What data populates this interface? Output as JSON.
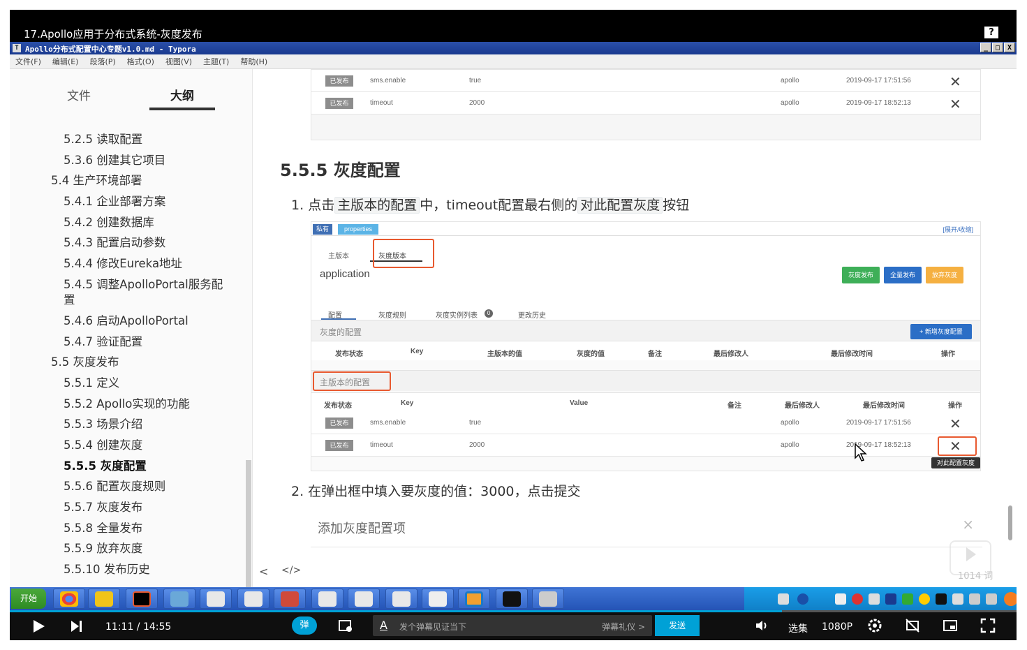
{
  "video": {
    "title": "17.Apollo应用于分布式系统-灰度发布",
    "help": "?"
  },
  "window": {
    "title": "Apollo分布式配置中心专题v1.0.md - Typora",
    "icon": "T",
    "buttons": [
      "_",
      "□",
      "X"
    ]
  },
  "menu": [
    "文件(F)",
    "编辑(E)",
    "段落(P)",
    "格式(O)",
    "视图(V)",
    "主题(T)",
    "帮助(H)"
  ],
  "sidebar": {
    "tab_file": "文件",
    "tab_outline": "大纲",
    "items": [
      {
        "label": "5.2.5 读取配置"
      },
      {
        "label": "5.3.6 创建其它项目"
      },
      {
        "label": "5.4 生产环境部署"
      },
      {
        "label": "5.4.1 企业部署方案"
      },
      {
        "label": "5.4.2 创建数据库"
      },
      {
        "label": "5.4.3 配置启动参数"
      },
      {
        "label": "5.4.4 修改Eureka地址"
      },
      {
        "label": "5.4.5 调整ApolloPortal服务配"
      },
      {
        "label": "置"
      },
      {
        "label": "5.4.6 启动ApolloPortal"
      },
      {
        "label": "5.4.7 验证配置"
      },
      {
        "label": "5.5 灰度发布"
      },
      {
        "label": "5.5.1 定义"
      },
      {
        "label": "5.5.2 Apollo实现的功能"
      },
      {
        "label": "5.5.3 场景介绍"
      },
      {
        "label": "5.5.4 创建灰度"
      },
      {
        "label": "5.5.5 灰度配置"
      },
      {
        "label": "5.5.6 配置灰度规则"
      },
      {
        "label": "5.5.7 灰度发布"
      },
      {
        "label": "5.5.8 全量发布"
      },
      {
        "label": "5.5.9 放弃灰度"
      },
      {
        "label": "5.5.10 发布历史"
      }
    ]
  },
  "doc": {
    "heading": "5.5.5 灰度配置",
    "step1_num": "1.",
    "step1_a": "点击",
    "step1_code1": "主版本的配置",
    "step1_b": "中，timeout配置最右侧的",
    "step1_code2": "对此配置灰度",
    "step1_c": "按钮",
    "step2": "2. 在弹出框中填入要灰度的值：3000，点击提交",
    "dialog_title": "添加灰度配置项",
    "dialog_close": "×",
    "nav_back": "<",
    "nav_code": "</>"
  },
  "shot1": {
    "rows": [
      {
        "status": "已发布",
        "key": "sms.enable",
        "value": "true",
        "user": "apollo",
        "time": "2019-09-17 17:51:56"
      },
      {
        "status": "已发布",
        "key": "timeout",
        "value": "2000",
        "user": "apollo",
        "time": "2019-09-17 18:52:13"
      }
    ]
  },
  "shot2": {
    "tag1": "私有",
    "tag2": "properties",
    "expand": "[展开/收缩]",
    "tab_main": "主版本",
    "tab_gray": "灰度版本",
    "app": "application",
    "btn_gray_publish": "灰度发布",
    "btn_full_publish": "全量发布",
    "btn_abandon": "放弃灰度",
    "subtabs": [
      "配置",
      "灰度规则",
      "灰度实例列表",
      "更改历史"
    ],
    "instance_count": "0",
    "gray_section": "灰度的配置",
    "add_gray": "+ 新增灰度配置",
    "gray_headers": [
      "发布状态",
      "Key",
      "主版本的值",
      "灰度的值",
      "备注",
      "最后修改人",
      "最后修改时间",
      "操作"
    ],
    "main_section": "主版本的配置",
    "main_headers": [
      "发布状态",
      "Key",
      "Value",
      "备注",
      "最后修改人",
      "最后修改时间",
      "操作"
    ],
    "rows": [
      {
        "status": "已发布",
        "key": "sms.enable",
        "value": "true",
        "user": "apollo",
        "time": "2019-09-17 17:51:56"
      },
      {
        "status": "已发布",
        "key": "timeout",
        "value": "2000",
        "user": "apollo",
        "time": "2019-09-17 18:52:13"
      }
    ],
    "tooltip": "对此配置灰度"
  },
  "overlay": {
    "danmaku_count": "1014 词"
  },
  "taskbar": {
    "start": "开始"
  },
  "player": {
    "time": "11:11 / 14:55",
    "danmu_toggle": "弹",
    "danmu_placeholder": "发个弹幕见证当下",
    "danmu_etiquette": "弹幕礼仪 >",
    "send": "发送",
    "select": "选集",
    "quality": "1080P",
    "progress": 0.767
  }
}
